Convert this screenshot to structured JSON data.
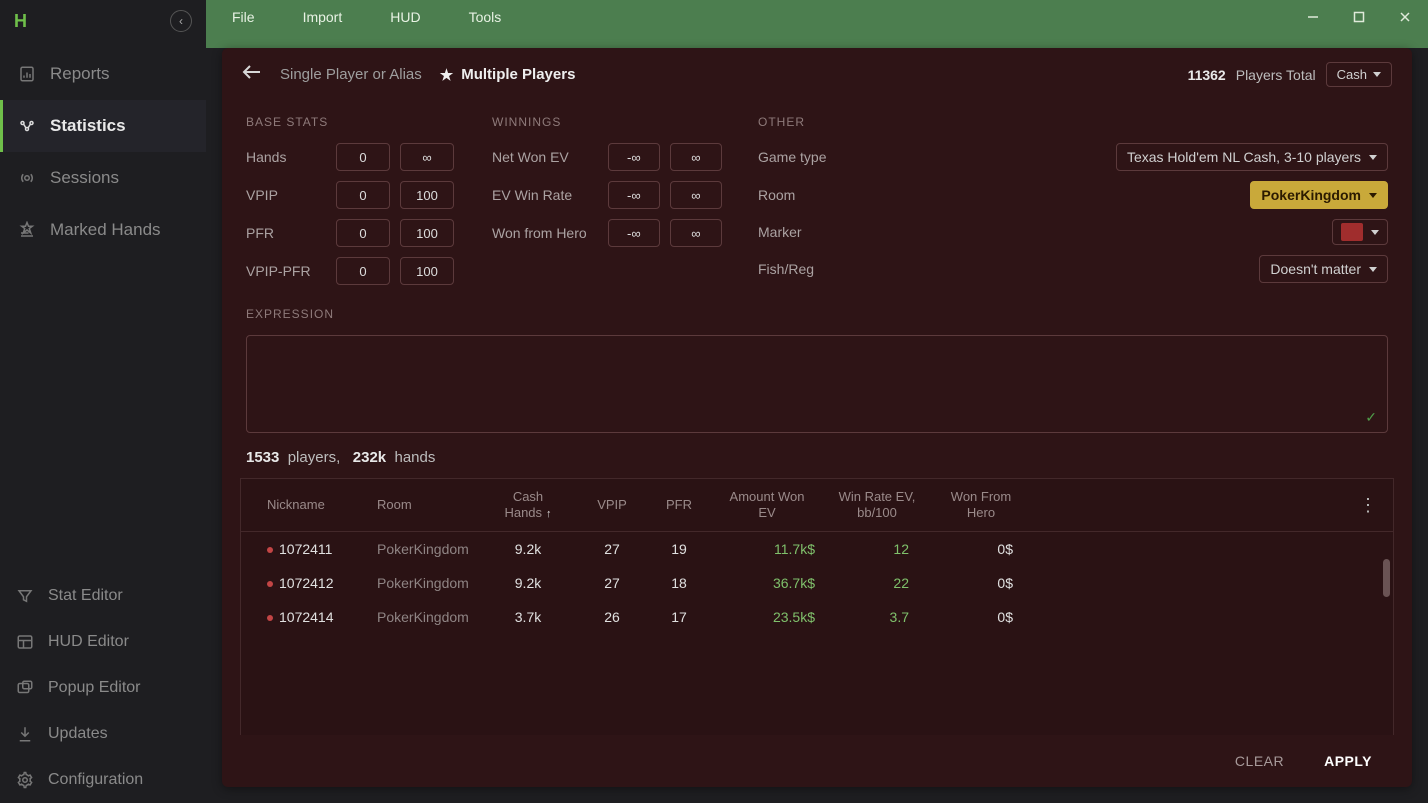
{
  "menu": {
    "file": "File",
    "import": "Import",
    "hud": "HUD",
    "tools": "Tools"
  },
  "sidebar": {
    "top": [
      {
        "key": "reports",
        "label": "Reports"
      },
      {
        "key": "statistics",
        "label": "Statistics"
      },
      {
        "key": "sessions",
        "label": "Sessions"
      },
      {
        "key": "marked",
        "label": "Marked Hands"
      }
    ],
    "bottom": [
      {
        "key": "stat-editor",
        "label": "Stat Editor"
      },
      {
        "key": "hud-editor",
        "label": "HUD Editor"
      },
      {
        "key": "popup-editor",
        "label": "Popup Editor"
      },
      {
        "key": "updates",
        "label": "Updates"
      },
      {
        "key": "configuration",
        "label": "Configuration"
      }
    ],
    "active": "statistics"
  },
  "header": {
    "tab_single": "Single Player or Alias",
    "tab_multi": "Multiple Players",
    "players_total_count": "11362",
    "players_total_label": "Players Total",
    "cash_dd": "Cash"
  },
  "filters": {
    "base_title": "BASE STATS",
    "win_title": "WINNINGS",
    "other_title": "OTHER",
    "base": [
      {
        "label": "Hands",
        "min": "0",
        "max": "∞"
      },
      {
        "label": "VPIP",
        "min": "0",
        "max": "100"
      },
      {
        "label": "PFR",
        "min": "0",
        "max": "100"
      },
      {
        "label": "VPIP-PFR",
        "min": "0",
        "max": "100"
      }
    ],
    "win": [
      {
        "label": "Net Won EV",
        "min": "-∞",
        "max": "∞"
      },
      {
        "label": "EV Win Rate",
        "min": "-∞",
        "max": "∞"
      },
      {
        "label": "Won from Hero",
        "min": "-∞",
        "max": "∞"
      }
    ],
    "other": {
      "game_type_label": "Game type",
      "game_type_value": "Texas Hold'em NL Cash, 3-10 players",
      "room_label": "Room",
      "room_value": "PokerKingdom",
      "marker_label": "Marker",
      "fishreg_label": "Fish/Reg",
      "fishreg_value": "Doesn't matter"
    }
  },
  "expression": {
    "title": "EXPRESSION"
  },
  "summary": {
    "players_n": "1533",
    "players_l": "players,",
    "hands_n": "232k",
    "hands_l": "hands"
  },
  "table": {
    "columns": [
      "Nickname",
      "Room",
      "Cash Hands",
      "VPIP",
      "PFR",
      "Amount Won EV",
      "Win Rate EV, bb/100",
      "Won From Hero"
    ],
    "sort_col": "Cash Hands",
    "rows": [
      {
        "nick": "1072411",
        "room": "PokerKingdom",
        "cash": "9.2k",
        "vpip": "27",
        "pfr": "19",
        "awev": "11.7k$",
        "wr": "12",
        "wfh": "0$"
      },
      {
        "nick": "1072412",
        "room": "PokerKingdom",
        "cash": "9.2k",
        "vpip": "27",
        "pfr": "18",
        "awev": "36.7k$",
        "wr": "22",
        "wfh": "0$"
      },
      {
        "nick": "1072414",
        "room": "PokerKingdom",
        "cash": "3.7k",
        "vpip": "26",
        "pfr": "17",
        "awev": "23.5k$",
        "wr": "3.7",
        "wfh": "0$"
      }
    ]
  },
  "footer": {
    "clear": "CLEAR",
    "apply": "APPLY"
  }
}
